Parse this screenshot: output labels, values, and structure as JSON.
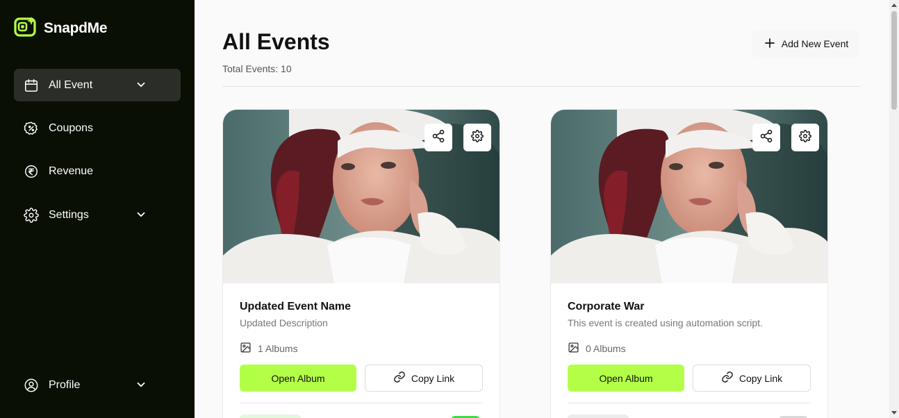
{
  "brand": {
    "name": "SnapdMe",
    "accent": "#b3ff48"
  },
  "sidebar": {
    "items": [
      {
        "label": "All Event",
        "icon": "calendar-icon",
        "active": true,
        "expandable": true
      },
      {
        "label": "Coupons",
        "icon": "coupon-icon",
        "active": false,
        "expandable": false
      },
      {
        "label": "Revenue",
        "icon": "rupee-icon",
        "active": false,
        "expandable": false
      },
      {
        "label": "Settings",
        "icon": "gear-icon",
        "active": false,
        "expandable": true
      }
    ],
    "profile": {
      "label": "Profile",
      "icon": "user-icon"
    }
  },
  "header": {
    "title": "All Events",
    "total_label": "Total Events: 10",
    "add_button": "Add New Event"
  },
  "events": [
    {
      "title": "Updated Event Name",
      "description": "Updated Description",
      "albums": "1 Albums",
      "open_label": "Open Album",
      "copy_label": "Copy Link",
      "status_color": "#3ddc46"
    },
    {
      "title": "Corporate War",
      "description": "This event is created using automation script.",
      "albums": "0 Albums",
      "open_label": "Open Album",
      "copy_label": "Copy Link",
      "status_color": "#d9d9d9"
    }
  ]
}
